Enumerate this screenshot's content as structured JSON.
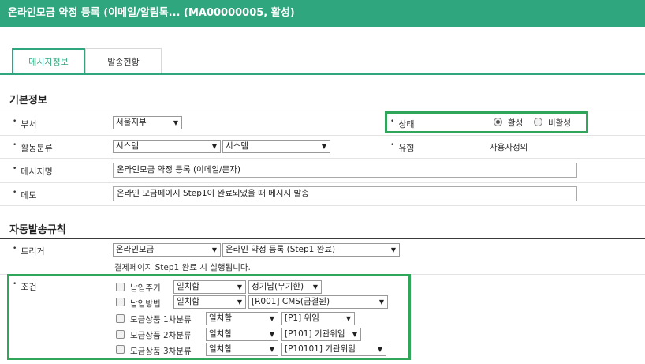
{
  "window": {
    "title": "온라인모금 약정 등록 (이메일/알림톡... (MA00000005, 활성)"
  },
  "tabs": [
    {
      "label": "메시지정보",
      "active": true
    },
    {
      "label": "발송현황",
      "active": false
    }
  ],
  "basic": {
    "heading": "기본정보",
    "dept": {
      "label": "부서",
      "value": "서울지부"
    },
    "status": {
      "label": "상태",
      "options": [
        "활성",
        "비활성"
      ],
      "selected": "활성"
    },
    "category": {
      "label": "활동분류",
      "value1": "시스템",
      "value2": "시스템"
    },
    "type": {
      "label": "유형",
      "value": "사용자정의"
    },
    "message_name": {
      "label": "메시지명",
      "value": "온라인모금 약정 등록 (이메일/문자)"
    },
    "memo": {
      "label": "메모",
      "value": "온라인 모금페이지 Step1이 완료되었을 때 메시지 발송"
    }
  },
  "rules": {
    "heading": "자동발송규칙",
    "trigger": {
      "label": "트리거",
      "value1": "온라인모금",
      "value2": "온라인 약정 등록 (Step1 완료)",
      "note": "결제페이지 Step1 완료 시 실행됩니다."
    },
    "condition": {
      "label": "조건",
      "rows": [
        {
          "name": "납입주기",
          "op": "일치함",
          "value": "정기납(무기한)"
        },
        {
          "name": "납입방법",
          "op": "일치함",
          "value": "[R001] CMS(금결원)"
        },
        {
          "name": "모금상품 1차분류",
          "op": "일치함",
          "value": "[P1] 위임"
        },
        {
          "name": "모금상품 2차분류",
          "op": "일치함",
          "value": "[P101] 기관위임"
        },
        {
          "name": "모금상품 3차분류",
          "op": "일치함",
          "value": "[P10101] 기관위임"
        }
      ]
    }
  },
  "colors": {
    "brand": "#2fa67e",
    "highlight": "#2fa65a"
  },
  "icons": {
    "dropdown": "triangle-down"
  }
}
